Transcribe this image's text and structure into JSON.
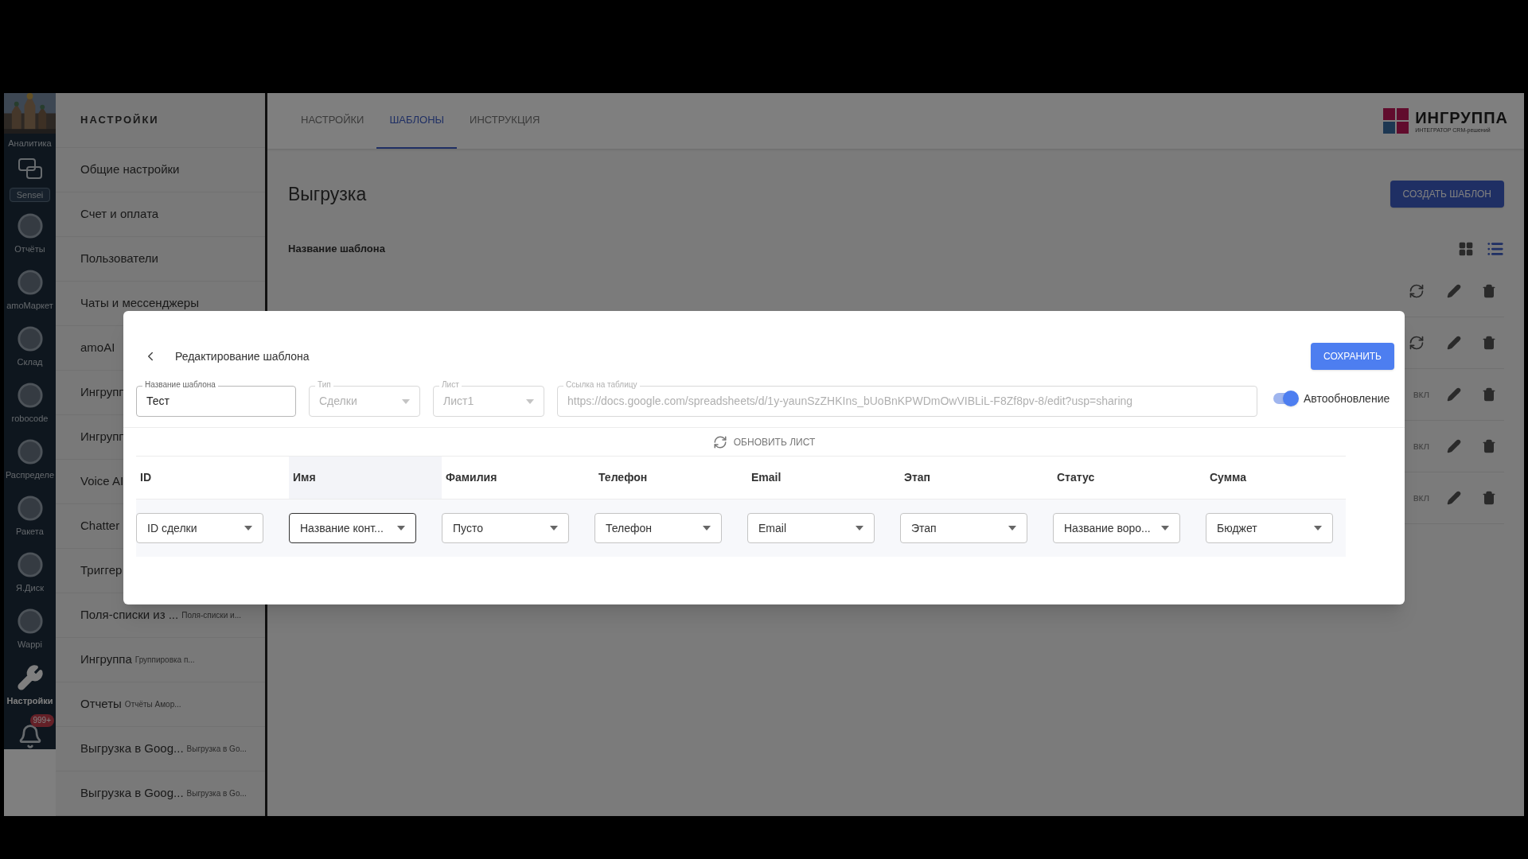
{
  "rail": {
    "items": [
      {
        "label": "Аналитика",
        "active": false
      },
      {
        "label": "Sensei",
        "kind": "tag",
        "active": false
      },
      {
        "label": "Отчёты",
        "kind": "icon",
        "active": false
      },
      {
        "label": "amoМаркет",
        "kind": "icon",
        "active": false
      },
      {
        "label": "Склад",
        "kind": "icon",
        "active": false
      },
      {
        "label": "robocode",
        "kind": "icon",
        "active": false
      },
      {
        "label": "Распределе",
        "kind": "icon",
        "active": false
      },
      {
        "label": "Ракета",
        "kind": "icon",
        "active": false
      },
      {
        "label": "Я.Диск",
        "kind": "icon",
        "active": false
      },
      {
        "label": "Wappi",
        "kind": "icon",
        "active": false
      },
      {
        "label": "Настройки",
        "kind": "icon",
        "active": true
      }
    ],
    "bell_badge": "999+"
  },
  "settings_menu": {
    "title": "НАСТРОЙКИ",
    "items": [
      {
        "label": "Общие настройки"
      },
      {
        "label": "Счет и оплата"
      },
      {
        "label": "Пользователи"
      },
      {
        "label": "Чаты и мессенджеры"
      },
      {
        "label": "amoAI"
      },
      {
        "label": "Ингрупп"
      },
      {
        "label": "Ингрупп"
      },
      {
        "label": "Voice AI"
      },
      {
        "label": "Chatter"
      },
      {
        "label": "Триггер"
      },
      {
        "label": "Поля-списки из ...",
        "note": "Поля-списки и..."
      },
      {
        "label": "Ингруппа",
        "note": "Группировка п..."
      },
      {
        "label": "Отчеты",
        "note": "Отчёты Амор..."
      },
      {
        "label": "Выгрузка в Goog...",
        "note": "Выгрузка в Go..."
      },
      {
        "label": "Выгрузка в Goog...",
        "note": "Выгрузка в Go..."
      }
    ]
  },
  "tabs": [
    {
      "label": "НАСТРОЙКИ",
      "selected": false
    },
    {
      "label": "ШАБЛОНЫ",
      "selected": true
    },
    {
      "label": "ИНСТРУКЦИЯ",
      "selected": false
    }
  ],
  "logo": {
    "name": "ИНГРУППА",
    "tagline": "ИНТЕГРАТОР CRM-решений"
  },
  "page": {
    "title": "Выгрузка",
    "create_button": "СОЗДАТЬ ШАБЛОН",
    "column_header": "Название шаблона",
    "views": [
      {
        "kind": "grid",
        "selected": false
      },
      {
        "kind": "list",
        "selected": true
      }
    ],
    "rows": [
      {
        "refresh": true
      },
      {
        "refresh": true
      },
      {
        "refresh": false,
        "status": "вкл"
      },
      {
        "refresh": false,
        "status": "вкл"
      },
      {
        "refresh": false,
        "status": "вкл"
      }
    ]
  },
  "dialog": {
    "title": "Редактирование шаблона",
    "save_button": "СОХРАНИТЬ",
    "fields": [
      {
        "label": "Название шаблона",
        "value": "Тест",
        "disabled": false,
        "dropdown": false
      },
      {
        "label": "Тип",
        "value": "Сделки",
        "disabled": true,
        "dropdown": true
      },
      {
        "label": "Лист",
        "value": "Лист1",
        "disabled": true,
        "dropdown": true
      },
      {
        "label": "Ссылка на таблицу",
        "value": "https://docs.google.com/spreadsheets/d/1y-yaunSzZHKIns_bUoBnKPWDmOwVIBLiL-F8Zf8pv-8/edit?usp=sharing",
        "disabled": true,
        "dropdown": false
      }
    ],
    "auto_update": {
      "label": "Автообновление",
      "on": true
    },
    "refresh_sheet": "ОБНОВИТЬ ЛИСТ",
    "mapping": [
      {
        "column": "ID",
        "value": "ID сделки",
        "selected": false
      },
      {
        "column": "Имя",
        "value": "Название конт...",
        "selected": true
      },
      {
        "column": "Фамилия",
        "value": "Пусто",
        "selected": false
      },
      {
        "column": "Телефон",
        "value": "Телефон",
        "selected": false
      },
      {
        "column": "Email",
        "value": "Email",
        "selected": false
      },
      {
        "column": "Этап",
        "value": "Этап",
        "selected": false
      },
      {
        "column": "Статус",
        "value": "Название воро...",
        "selected": false
      },
      {
        "column": "Сумма",
        "value": "Бюджет",
        "selected": false
      }
    ]
  }
}
